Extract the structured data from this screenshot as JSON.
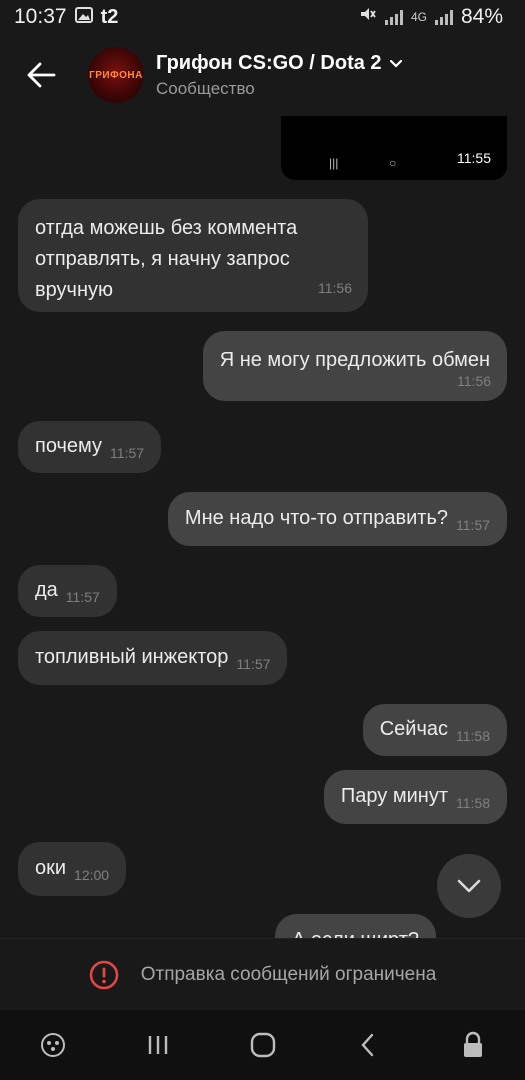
{
  "status_bar": {
    "time": "10:37",
    "carrier": "t2",
    "network": "4G",
    "battery": "84%"
  },
  "header": {
    "avatar_text": "ГРИФОНА",
    "title": "Грифон CS:GO / Dota 2",
    "subtitle": "Сообщество"
  },
  "media_message": {
    "time": "11:55"
  },
  "messages": [
    {
      "direction": "in",
      "text": "отгда можешь без коммента отправлять, я начну запрос вручную",
      "time": "11:56"
    },
    {
      "direction": "out",
      "text": "Я не могу предложить обмен",
      "time": "11:56"
    },
    {
      "direction": "in",
      "text": "почему",
      "time": "11:57"
    },
    {
      "direction": "out",
      "text": "Мне надо что-то отправить?",
      "time": "11:57"
    },
    {
      "direction": "in",
      "text": "да",
      "time": "11:57"
    },
    {
      "direction": "in",
      "text": "топливный инжектор",
      "time": "11:57"
    },
    {
      "direction": "out",
      "text": "Сейчас",
      "time": "11:58"
    },
    {
      "direction": "out",
      "text": "Пару минут",
      "time": "11:58"
    },
    {
      "direction": "in",
      "text": "оки",
      "time": "12:00"
    },
    {
      "direction": "out",
      "text": "А если щирт?",
      "time": ""
    }
  ],
  "restriction": {
    "text": "Отправка сообщений ограничена"
  },
  "icons": {
    "back": "arrow-left-icon",
    "chevron": "chevron-down-icon",
    "scroll_down": "chevron-down-icon",
    "alert": "exclamation-circle-icon",
    "game": "gamepad-icon",
    "recents": "recents-icon",
    "home": "home-icon",
    "nav_back": "chevron-left-icon",
    "lock": "lock-icon"
  },
  "colors": {
    "background": "#191919",
    "incoming_bubble": "#323232",
    "outgoing_bubble": "#444444",
    "alert_red": "#e64646"
  }
}
